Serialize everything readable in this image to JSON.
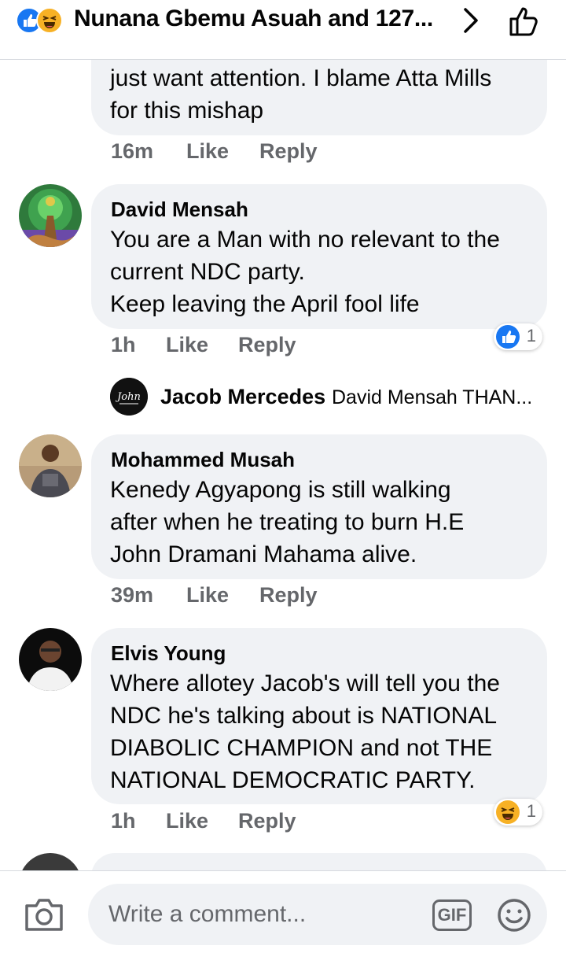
{
  "header": {
    "title": "Nunana Gbemu Asuah and 127...",
    "icons": [
      "like-reaction-icon",
      "haha-reaction-icon",
      "chevron-right-icon",
      "thumbs-up-outline-icon"
    ]
  },
  "comments": [
    {
      "text": "just want attention. I blame Atta Mills\nfor this mishap",
      "time": "16m",
      "like_label": "Like",
      "reply_label": "Reply"
    },
    {
      "author": "David Mensah",
      "text": "You are a Man with no relevant to the\ncurrent NDC party.\nKeep leaving the April fool life",
      "time": "1h",
      "like_label": "Like",
      "reply_label": "Reply",
      "reaction": {
        "icon": "like-reaction-icon",
        "count": "1"
      }
    },
    {
      "author": "Mohammed Musah",
      "text": "Kenedy Agyapong is still walking\nafter when he treating to burn H.E\nJohn Dramani Mahama alive.",
      "time": "39m",
      "like_label": "Like",
      "reply_label": "Reply"
    },
    {
      "author": "Elvis Young",
      "text": "Where allotey Jacob's will tell you the\nNDC he's talking about is NATIONAL\nDIABOLIC CHAMPION   and not THE\nNATIONAL DEMOCRATIC PARTY.",
      "time": "1h",
      "like_label": "Like",
      "reply_label": "Reply",
      "reaction": {
        "icon": "haha-reaction-icon",
        "count": "1"
      }
    }
  ],
  "reply_preview": {
    "author": "Jacob Mercedes",
    "text": "David Mensah  THAN..."
  },
  "composer": {
    "placeholder": "Write a comment...",
    "gif_label": "GIF"
  },
  "colors": {
    "accent": "#1877f2",
    "bubble": "#f0f2f5",
    "meta": "#65676b",
    "haha": "#f7b125"
  }
}
